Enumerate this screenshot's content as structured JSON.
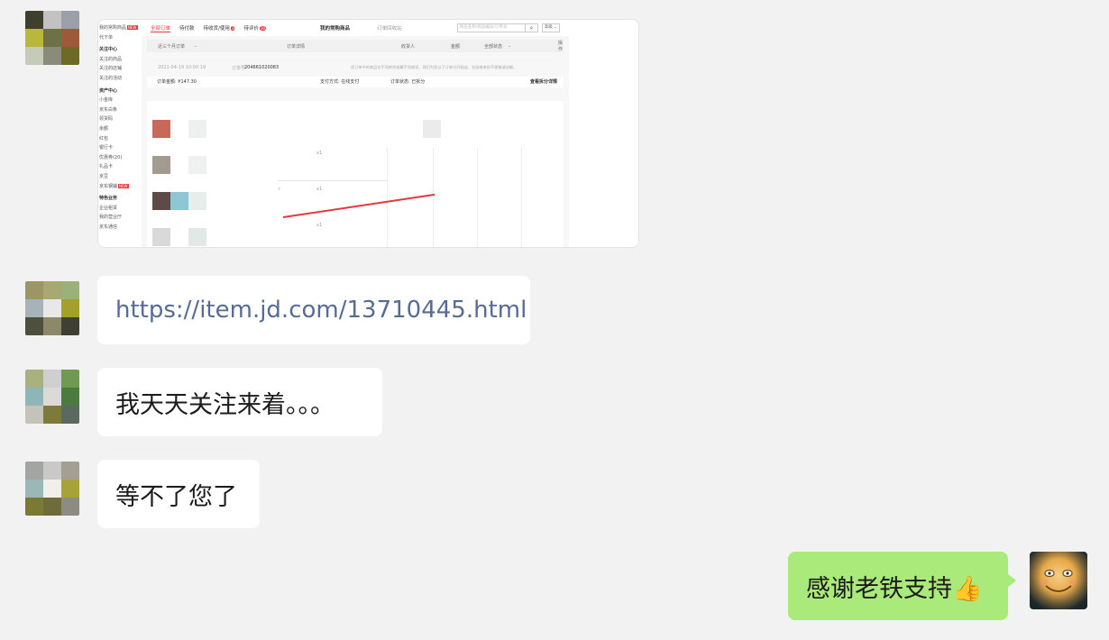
{
  "screenshot_thumbnail": {
    "sidebar": [
      {
        "label": "我的常购商品",
        "badge": "NEW"
      },
      {
        "label": "代下单"
      },
      {
        "label": "关注中心",
        "heading": true
      },
      {
        "label": "关注的商品"
      },
      {
        "label": "关注的店铺"
      },
      {
        "label": "关注的活动"
      },
      {
        "label": "资产中心",
        "heading": true
      },
      {
        "label": "小金库"
      },
      {
        "label": "京东白条"
      },
      {
        "label": "领货码"
      },
      {
        "label": "余额"
      },
      {
        "label": "红包"
      },
      {
        "label": "银行卡"
      },
      {
        "label": "优惠券(20)"
      },
      {
        "label": "礼品卡"
      },
      {
        "label": "京豆"
      },
      {
        "label": "京东钢镚",
        "badge": "NEW"
      },
      {
        "label": "特色业务",
        "heading": true
      },
      {
        "label": "企业租赁"
      },
      {
        "label": "我的营业厅"
      },
      {
        "label": "京东通信"
      }
    ],
    "tabs": {
      "all": "全部订单",
      "pay": "待付款",
      "receive": "待收货/使用",
      "receive_count": "3",
      "review": "待评价",
      "review_count": "30",
      "frequent": "我的常购商品",
      "recycle": "订单回收站"
    },
    "search_placeholder": "商品名称/商品编号/订单号",
    "search_advanced": "高级 ⌄",
    "table_head": {
      "range": "近三个月订单",
      "detail": "订单详情",
      "consignee": "收货人",
      "amount": "金额",
      "status": "全部状态",
      "action": "操作"
    },
    "order": {
      "time": "2021-04-19 10:00:19",
      "number_label": "订单号:",
      "number": "204661020083",
      "notice": "您订单中的商品在不同库房或属不同商家，我们为您以下订单分开配送，包括带来的不便敬请谅解。",
      "total": "订单金额: ¥147.30",
      "pay_method": "支付方式: 在线支付",
      "order_status": "订单状态: 已拆分",
      "view_detail": "查看拆分详情"
    },
    "qty_marks": [
      "x1",
      "x1",
      "x1"
    ],
    "slash_mark": "r"
  },
  "messages": [
    {
      "sender": "other",
      "type": "image"
    },
    {
      "sender": "other",
      "type": "link",
      "text": "https://item.jd.com/13710445.html"
    },
    {
      "sender": "other",
      "type": "text",
      "text": "我天天关注来着。。。"
    },
    {
      "sender": "other",
      "type": "text",
      "text": "等不了您了"
    },
    {
      "sender": "me",
      "type": "text",
      "text": "感谢老铁支持👍"
    }
  ],
  "colors": {
    "background": "#f2f2f2",
    "bubble_other": "#ffffff",
    "bubble_me": "#a9ea7a",
    "link": "#576b95",
    "jd_red": "#e4393c"
  }
}
